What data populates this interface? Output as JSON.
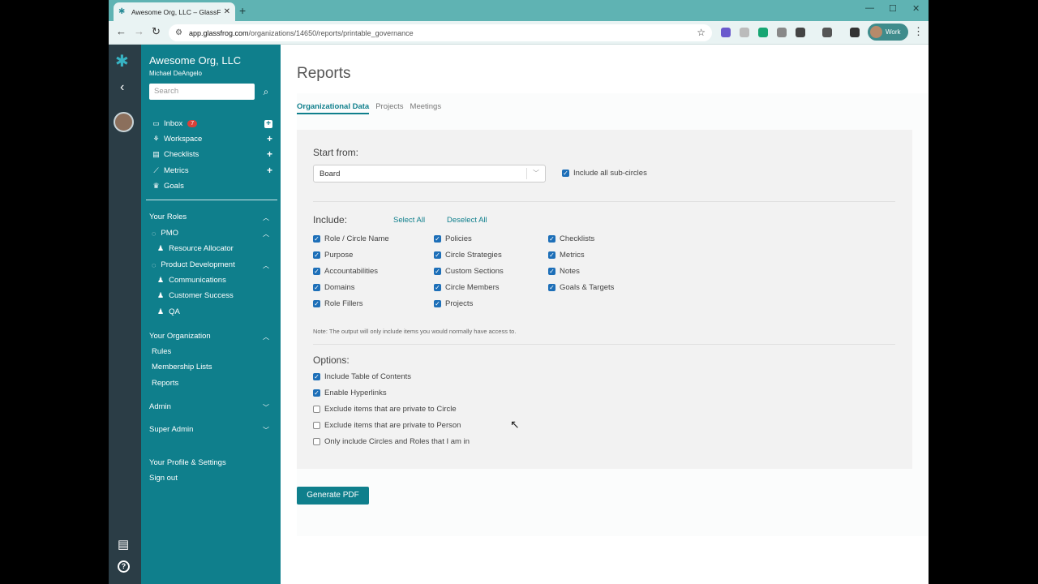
{
  "browser": {
    "tab_title": "Awesome Org, LLC – GlassFrog",
    "url_host": "app.glassfrog.com",
    "url_path": "/organizations/14650/reports/printable_governance",
    "profile_label": "Work",
    "new_tab": "+",
    "minimize": "—",
    "maximize": "☐",
    "close": "✕"
  },
  "sidebar": {
    "org_name": "Awesome Org, LLC",
    "user_name": "Michael DeAngelo",
    "search_placeholder": "Search",
    "nav": [
      {
        "label": "Inbox",
        "badge": "7"
      },
      {
        "label": "Workspace"
      },
      {
        "label": "Checklists"
      },
      {
        "label": "Metrics"
      },
      {
        "label": "Goals"
      }
    ],
    "your_roles": "Your Roles",
    "roles": [
      {
        "label": "PMO"
      },
      {
        "label": "Resource Allocator"
      },
      {
        "label": "Product Development"
      },
      {
        "label": "Communications"
      },
      {
        "label": "Customer Success"
      },
      {
        "label": "QA"
      }
    ],
    "your_organization": "Your Organization",
    "org_links": [
      "Rules",
      "Membership Lists",
      "Reports"
    ],
    "admin": "Admin",
    "super_admin": "Super Admin",
    "profile_settings": "Your Profile & Settings",
    "sign_out": "Sign out"
  },
  "main": {
    "title": "Reports",
    "tabs": [
      "Organizational Data",
      "Projects",
      "Meetings"
    ],
    "start_from_label": "Start from:",
    "start_from_value": "Board",
    "include_subcircles": "Include all sub-circles",
    "include_label": "Include:",
    "select_all": "Select All",
    "deselect_all": "Deselect All",
    "include_col1": [
      "Role / Circle Name",
      "Purpose",
      "Accountabilities",
      "Domains",
      "Role Fillers"
    ],
    "include_col2": [
      "Policies",
      "Circle Strategies",
      "Custom Sections",
      "Circle Members",
      "Projects"
    ],
    "include_col3": [
      "Checklists",
      "Metrics",
      "Notes",
      "Goals & Targets"
    ],
    "note": "Note: The output will only include items you would normally have access to.",
    "options_label": "Options:",
    "options": [
      {
        "label": "Include Table of Contents",
        "checked": true
      },
      {
        "label": "Enable Hyperlinks",
        "checked": true
      },
      {
        "label": "Exclude items that are private to Circle",
        "checked": false
      },
      {
        "label": "Exclude items that are private to Person",
        "checked": false
      },
      {
        "label": "Only include Circles and Roles that I am in",
        "checked": false
      }
    ],
    "generate_button": "Generate PDF"
  }
}
